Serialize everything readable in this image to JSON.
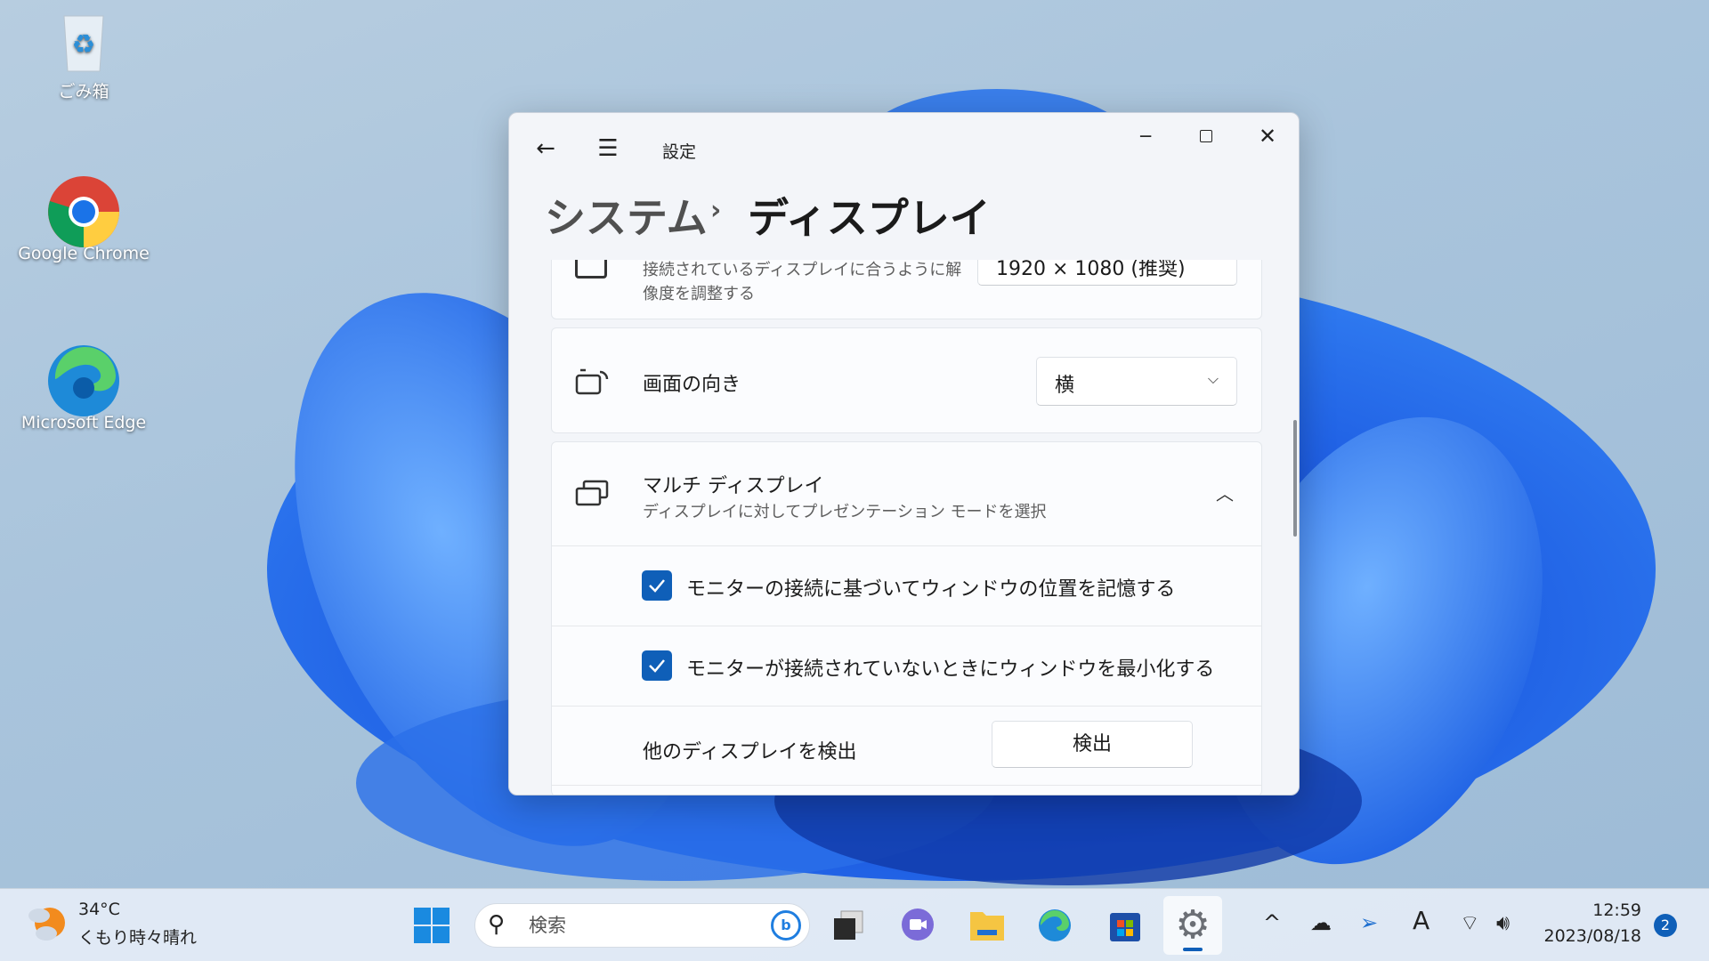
{
  "desktop": {
    "icons": [
      {
        "label": "ごみ箱",
        "icon": "recycle-bin-icon"
      },
      {
        "label": "Google Chrome",
        "icon": "chrome-icon"
      },
      {
        "label": "Microsoft Edge",
        "icon": "edge-icon"
      }
    ]
  },
  "window": {
    "title": "設定",
    "breadcrumb": {
      "parent": "システム",
      "current": "ディスプレイ"
    }
  },
  "settings": {
    "resolution": {
      "description_line1": "接続されているディスプレイに合うように解",
      "description_line2": "像度を調整する",
      "value": "1920 × 1080 (推奨)"
    },
    "orientation": {
      "label": "画面の向き",
      "value": "横"
    },
    "multi_display": {
      "title": "マルチ ディスプレイ",
      "subtitle": "ディスプレイに対してプレゼンテーション モードを選択",
      "expanded": true,
      "options": [
        {
          "label": "モニターの接続に基づいてウィンドウの位置を記憶する",
          "checked": true
        },
        {
          "label": "モニターが接続されていないときにウィンドウを最小化する",
          "checked": true
        }
      ],
      "detect": {
        "label": "他のディスプレイを検出",
        "button": "検出"
      }
    }
  },
  "taskbar": {
    "weather": {
      "temp": "34°C",
      "condition": "くもり時々晴れ"
    },
    "search_placeholder": "検索",
    "clock": {
      "time": "12:59",
      "date": "2023/08/18"
    },
    "notification_count": "2"
  },
  "colors": {
    "accent": "#0f5fb8"
  }
}
